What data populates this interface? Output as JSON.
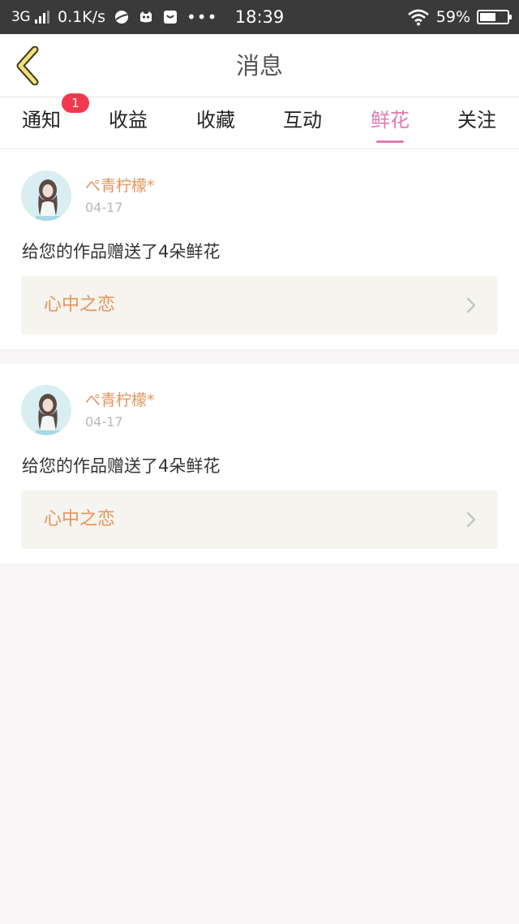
{
  "status_bar": {
    "network": "3G",
    "speed": "0.1K/s",
    "time": "18:39",
    "battery_text": "59%",
    "battery_level": 0.59
  },
  "header": {
    "title": "消息",
    "back_icon": "chevron-left-icon"
  },
  "tabs": [
    {
      "label": "通知",
      "badge": "1",
      "active": false
    },
    {
      "label": "收益",
      "active": false
    },
    {
      "label": "收藏",
      "active": false
    },
    {
      "label": "互动",
      "active": false
    },
    {
      "label": "鲜花",
      "active": true
    },
    {
      "label": "关注",
      "active": false
    }
  ],
  "colors": {
    "accent_pink": "#e07bb0",
    "name_orange": "#e7945a",
    "badge_red": "#f2384e"
  },
  "messages": [
    {
      "user": "ぺ青柠檬*",
      "date": "04-17",
      "text": "给您的作品赠送了4朵鲜花",
      "work_title": "心中之恋"
    },
    {
      "user": "ぺ青柠檬*",
      "date": "04-17",
      "text": "给您的作品赠送了4朵鲜花",
      "work_title": "心中之恋"
    }
  ]
}
